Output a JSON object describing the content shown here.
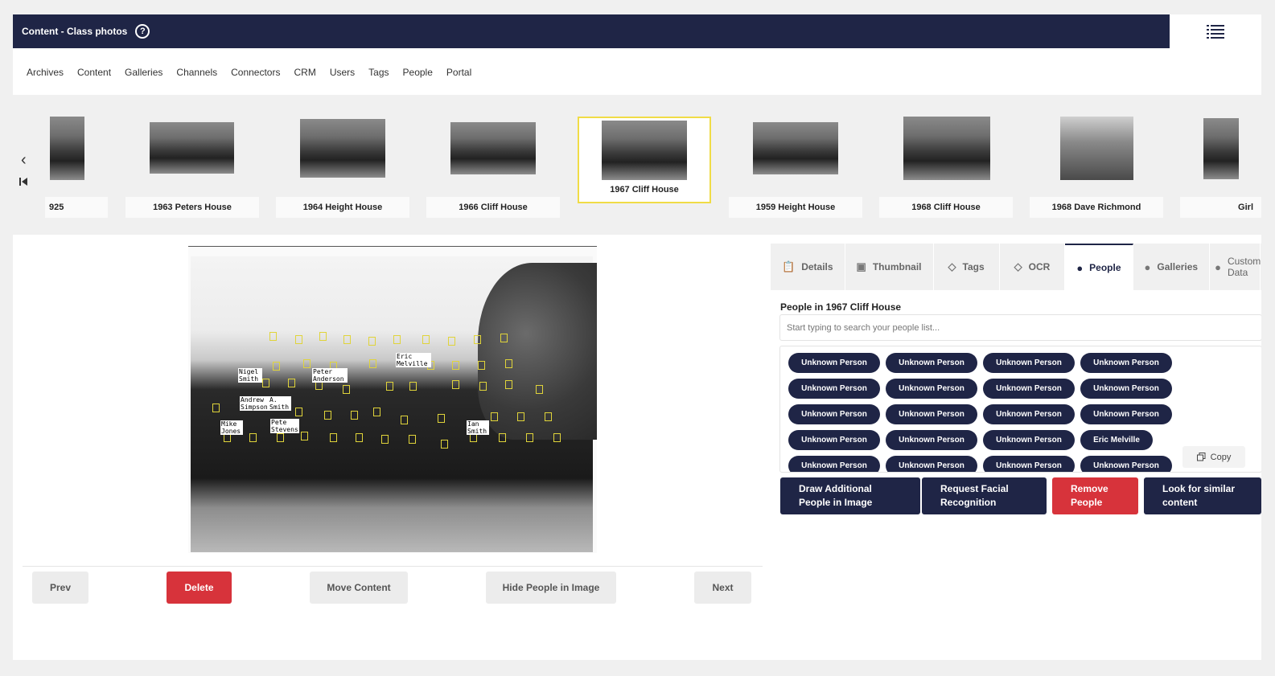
{
  "header": {
    "title": "Content - Class photos"
  },
  "nav": [
    "Archives",
    "Content",
    "Galleries",
    "Channels",
    "Connectors",
    "CRM",
    "Users",
    "Tags",
    "People",
    "Portal"
  ],
  "strip": {
    "items": [
      {
        "label": "925"
      },
      {
        "label": "1963 Peters House"
      },
      {
        "label": "1964 Height House"
      },
      {
        "label": "1966 Cliff House"
      },
      {
        "label": "1967 Cliff House"
      },
      {
        "label": "1959 Height House"
      },
      {
        "label": "1968 Cliff House"
      },
      {
        "label": "1968 Dave Richmond"
      },
      {
        "label": "Girl"
      }
    ]
  },
  "photo": {
    "name_tags": [
      "Nigel Smith",
      "Peter Anderson",
      "Eric Melville",
      "Andrew Simpson",
      "A. Smith",
      "Mike Jones",
      "Pete Stevens",
      "Ian Smith"
    ]
  },
  "controls": {
    "prev": "Prev",
    "delete": "Delete",
    "move": "Move Content",
    "hide": "Hide People in Image",
    "next": "Next"
  },
  "tabs": [
    "Details",
    "Thumbnail",
    "Tags",
    "OCR",
    "People",
    "Galleries",
    "Custom Data"
  ],
  "people": {
    "title": "People in 1967 Cliff House",
    "search_placeholder": "Start typing to search your people list...",
    "unknown": "Unknown Person",
    "named": "Eric Melville",
    "copy": "Copy"
  },
  "actions": {
    "draw": "Draw Additional People in Image",
    "facial": "Request Facial Recognition",
    "remove": "Remove People",
    "similar": "Look for similar content"
  }
}
